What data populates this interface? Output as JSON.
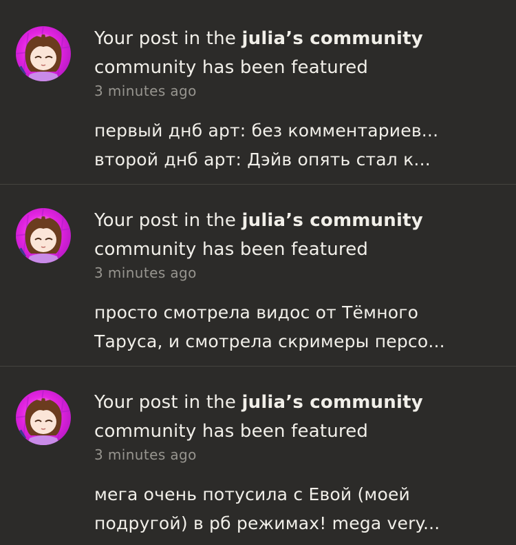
{
  "notifications": [
    {
      "title_prefix": "Your post in the ",
      "community_name": "julia’s community",
      "title_suffix": "community has been featured",
      "time": "3 minutes ago",
      "excerpt_line1": "первый днб арт: без комментариев...",
      "excerpt_line2": "второй днб арт: Дэйв опять стал к..."
    },
    {
      "title_prefix": "Your post in the ",
      "community_name": "julia’s community",
      "title_suffix": "community has been featured",
      "time": "3 minutes ago",
      "excerpt_line1": "просто смотрела видос от Тёмного",
      "excerpt_line2": "Таруса, и смотрела скримеры персо..."
    },
    {
      "title_prefix": "Your post in the ",
      "community_name": "julia’s community",
      "title_suffix": "community has been featured",
      "time": "3 minutes ago",
      "excerpt_line1": "мега очень потусила с Евой (моей",
      "excerpt_line2": "подругой) в рб режимах! mega very..."
    }
  ],
  "colors": {
    "background": "#2c2b29",
    "text": "#f1efe9",
    "muted": "#97958f",
    "avatar_bg": "#e224e0"
  },
  "icons": {
    "avatar": "avatar-anime-girl-icon"
  }
}
